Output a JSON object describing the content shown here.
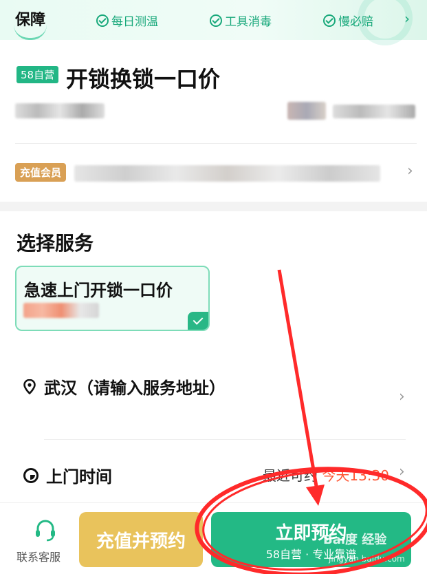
{
  "guarantee": {
    "title": "保障",
    "items": [
      "每日测温",
      "工具消毒",
      "慢必赔"
    ],
    "more_icon": "chevron-right-icon"
  },
  "product": {
    "badge": "58自营",
    "title": "开锁换锁一口价",
    "vip_badge": "充值会员"
  },
  "service": {
    "section_title": "选择服务",
    "card_name": "急速上门开锁一口价"
  },
  "address": {
    "text": "武汉（请输入服务地址）"
  },
  "time": {
    "label": "上门时间",
    "hint": "最近可约",
    "value": "今天13:30"
  },
  "bottom": {
    "cs_label": "联系客服",
    "charge_button": "充值并预约",
    "book_button": "立即预约",
    "book_sub": "58自营 · 专业靠谱"
  },
  "watermark": {
    "brand": "Bai度 经验",
    "url": "jingyan.baidu.com"
  },
  "colors": {
    "accent": "#23b985",
    "charge": "#e9c35c",
    "hot": "#ff5533",
    "annotation": "#ff2a2a"
  }
}
